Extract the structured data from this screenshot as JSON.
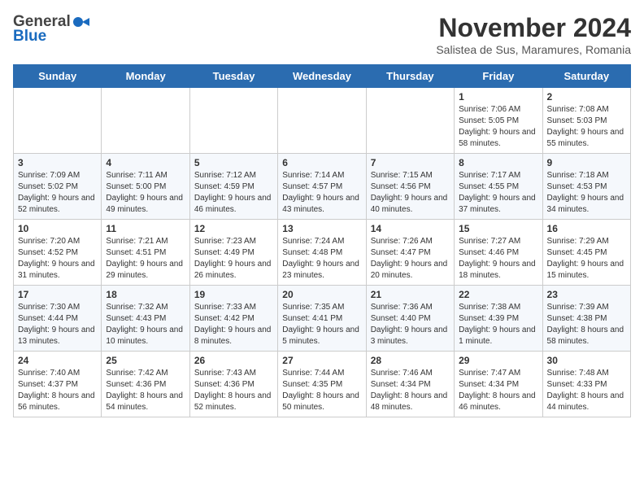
{
  "header": {
    "logo_general": "General",
    "logo_blue": "Blue",
    "month_title": "November 2024",
    "subtitle": "Salistea de Sus, Maramures, Romania"
  },
  "weekdays": [
    "Sunday",
    "Monday",
    "Tuesday",
    "Wednesday",
    "Thursday",
    "Friday",
    "Saturday"
  ],
  "weeks": [
    [
      {
        "day": "",
        "info": ""
      },
      {
        "day": "",
        "info": ""
      },
      {
        "day": "",
        "info": ""
      },
      {
        "day": "",
        "info": ""
      },
      {
        "day": "",
        "info": ""
      },
      {
        "day": "1",
        "info": "Sunrise: 7:06 AM\nSunset: 5:05 PM\nDaylight: 9 hours and 58 minutes."
      },
      {
        "day": "2",
        "info": "Sunrise: 7:08 AM\nSunset: 5:03 PM\nDaylight: 9 hours and 55 minutes."
      }
    ],
    [
      {
        "day": "3",
        "info": "Sunrise: 7:09 AM\nSunset: 5:02 PM\nDaylight: 9 hours and 52 minutes."
      },
      {
        "day": "4",
        "info": "Sunrise: 7:11 AM\nSunset: 5:00 PM\nDaylight: 9 hours and 49 minutes."
      },
      {
        "day": "5",
        "info": "Sunrise: 7:12 AM\nSunset: 4:59 PM\nDaylight: 9 hours and 46 minutes."
      },
      {
        "day": "6",
        "info": "Sunrise: 7:14 AM\nSunset: 4:57 PM\nDaylight: 9 hours and 43 minutes."
      },
      {
        "day": "7",
        "info": "Sunrise: 7:15 AM\nSunset: 4:56 PM\nDaylight: 9 hours and 40 minutes."
      },
      {
        "day": "8",
        "info": "Sunrise: 7:17 AM\nSunset: 4:55 PM\nDaylight: 9 hours and 37 minutes."
      },
      {
        "day": "9",
        "info": "Sunrise: 7:18 AM\nSunset: 4:53 PM\nDaylight: 9 hours and 34 minutes."
      }
    ],
    [
      {
        "day": "10",
        "info": "Sunrise: 7:20 AM\nSunset: 4:52 PM\nDaylight: 9 hours and 31 minutes."
      },
      {
        "day": "11",
        "info": "Sunrise: 7:21 AM\nSunset: 4:51 PM\nDaylight: 9 hours and 29 minutes."
      },
      {
        "day": "12",
        "info": "Sunrise: 7:23 AM\nSunset: 4:49 PM\nDaylight: 9 hours and 26 minutes."
      },
      {
        "day": "13",
        "info": "Sunrise: 7:24 AM\nSunset: 4:48 PM\nDaylight: 9 hours and 23 minutes."
      },
      {
        "day": "14",
        "info": "Sunrise: 7:26 AM\nSunset: 4:47 PM\nDaylight: 9 hours and 20 minutes."
      },
      {
        "day": "15",
        "info": "Sunrise: 7:27 AM\nSunset: 4:46 PM\nDaylight: 9 hours and 18 minutes."
      },
      {
        "day": "16",
        "info": "Sunrise: 7:29 AM\nSunset: 4:45 PM\nDaylight: 9 hours and 15 minutes."
      }
    ],
    [
      {
        "day": "17",
        "info": "Sunrise: 7:30 AM\nSunset: 4:44 PM\nDaylight: 9 hours and 13 minutes."
      },
      {
        "day": "18",
        "info": "Sunrise: 7:32 AM\nSunset: 4:43 PM\nDaylight: 9 hours and 10 minutes."
      },
      {
        "day": "19",
        "info": "Sunrise: 7:33 AM\nSunset: 4:42 PM\nDaylight: 9 hours and 8 minutes."
      },
      {
        "day": "20",
        "info": "Sunrise: 7:35 AM\nSunset: 4:41 PM\nDaylight: 9 hours and 5 minutes."
      },
      {
        "day": "21",
        "info": "Sunrise: 7:36 AM\nSunset: 4:40 PM\nDaylight: 9 hours and 3 minutes."
      },
      {
        "day": "22",
        "info": "Sunrise: 7:38 AM\nSunset: 4:39 PM\nDaylight: 9 hours and 1 minute."
      },
      {
        "day": "23",
        "info": "Sunrise: 7:39 AM\nSunset: 4:38 PM\nDaylight: 8 hours and 58 minutes."
      }
    ],
    [
      {
        "day": "24",
        "info": "Sunrise: 7:40 AM\nSunset: 4:37 PM\nDaylight: 8 hours and 56 minutes."
      },
      {
        "day": "25",
        "info": "Sunrise: 7:42 AM\nSunset: 4:36 PM\nDaylight: 8 hours and 54 minutes."
      },
      {
        "day": "26",
        "info": "Sunrise: 7:43 AM\nSunset: 4:36 PM\nDaylight: 8 hours and 52 minutes."
      },
      {
        "day": "27",
        "info": "Sunrise: 7:44 AM\nSunset: 4:35 PM\nDaylight: 8 hours and 50 minutes."
      },
      {
        "day": "28",
        "info": "Sunrise: 7:46 AM\nSunset: 4:34 PM\nDaylight: 8 hours and 48 minutes."
      },
      {
        "day": "29",
        "info": "Sunrise: 7:47 AM\nSunset: 4:34 PM\nDaylight: 8 hours and 46 minutes."
      },
      {
        "day": "30",
        "info": "Sunrise: 7:48 AM\nSunset: 4:33 PM\nDaylight: 8 hours and 44 minutes."
      }
    ]
  ]
}
